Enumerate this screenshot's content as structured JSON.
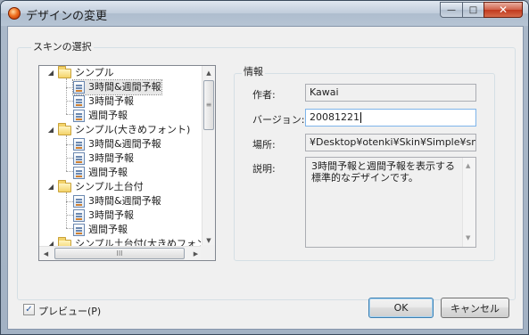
{
  "window": {
    "title": "デザインの変更",
    "controls": {
      "minimize": "—",
      "maximize": "□",
      "close": "✕"
    }
  },
  "skin_group": {
    "label": "スキンの選択"
  },
  "tree": {
    "expand_glyph": "◢",
    "items": [
      {
        "label": "シンプル",
        "type": "folder"
      },
      {
        "label": "3時間&週間予報",
        "type": "skin",
        "selected": true
      },
      {
        "label": "3時間予報",
        "type": "skin"
      },
      {
        "label": "週間予報",
        "type": "skin"
      },
      {
        "label": "シンプル(大きめフォント)",
        "type": "folder"
      },
      {
        "label": "3時間&週間予報",
        "type": "skin"
      },
      {
        "label": "3時間予報",
        "type": "skin"
      },
      {
        "label": "週間予報",
        "type": "skin"
      },
      {
        "label": "シンプル土台付",
        "type": "folder"
      },
      {
        "label": "3時間&週間予報",
        "type": "skin"
      },
      {
        "label": "3時間予報",
        "type": "skin"
      },
      {
        "label": "週間予報",
        "type": "skin"
      },
      {
        "label": "シンプル土台付(大きめフォン",
        "type": "folder"
      }
    ],
    "scroll": {
      "up": "▲",
      "down": "▼",
      "left": "◀",
      "right": "▶",
      "grip_v": "≡",
      "grip_h": "III"
    }
  },
  "info": {
    "label": "情報",
    "author_label": "作者:",
    "author_value": "Kawai",
    "version_label": "バージョン:",
    "version_value": "20081221",
    "location_label": "場所:",
    "location_value": "¥Desktop¥otenki¥Skin¥Simple¥small.ini",
    "description_label": "説明:",
    "description_value": "3時間予報と週間予報を表示する標準的なデザインです。",
    "desc_scroll": {
      "up": "▲",
      "down": "▼"
    }
  },
  "preview": {
    "label": "プレビュー(P)",
    "checked": true,
    "check_glyph": "✓"
  },
  "buttons": {
    "ok": "OK",
    "cancel": "キャンセル"
  }
}
